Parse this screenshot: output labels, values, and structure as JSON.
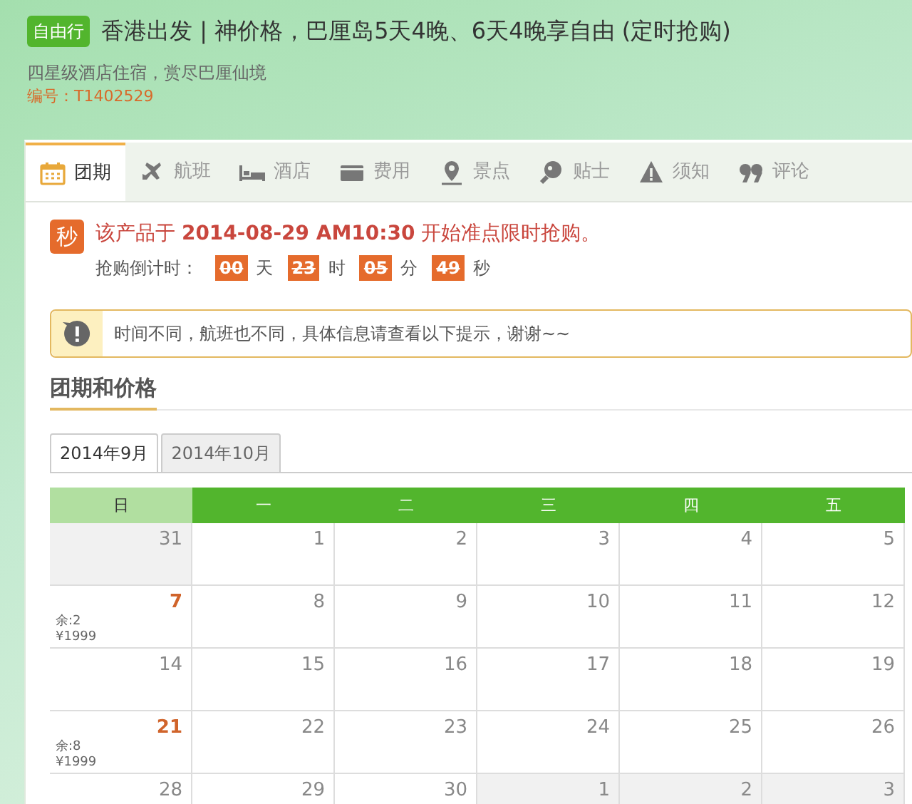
{
  "header": {
    "badge": "自由行",
    "title": "香港出发 | 神价格，巴厘岛5天4晚、6天4晚享自由 (定时抢购)",
    "subtitle": "四星级酒店住宿，赏尽巴厘仙境",
    "code": "编号：T1402529"
  },
  "tabs": [
    {
      "label": "团期",
      "selected": true
    },
    {
      "label": "航班",
      "selected": false
    },
    {
      "label": "酒店",
      "selected": false
    },
    {
      "label": "费用",
      "selected": false
    },
    {
      "label": "景点",
      "selected": false
    },
    {
      "label": "贴士",
      "selected": false
    },
    {
      "label": "须知",
      "selected": false
    },
    {
      "label": "评论",
      "selected": false
    }
  ],
  "sale": {
    "badge": "秒",
    "message": "该产品于 **2014-08-29 AM10:30** 开始准点限时抢购。",
    "countdown_label": "抢购倒计时：",
    "countdown": [
      {
        "value": "00",
        "unit": "天"
      },
      {
        "value": "23",
        "unit": "时"
      },
      {
        "value": "05",
        "unit": "分"
      },
      {
        "value": "49",
        "unit": "秒"
      }
    ]
  },
  "notice": "时间不同，航班也不同，具体信息请查看以下提示，谢谢~~",
  "section_title": "团期和价格",
  "month_tabs": [
    {
      "label": "2014年9月",
      "selected": true
    },
    {
      "label": "2014年10月",
      "selected": false
    }
  ],
  "calendar": {
    "weekdays": [
      "日",
      "一",
      "二",
      "三",
      "四",
      "五"
    ],
    "weeks": [
      [
        {
          "day": "31",
          "in_month": false
        },
        {
          "day": "1",
          "in_month": true
        },
        {
          "day": "2",
          "in_month": true
        },
        {
          "day": "3",
          "in_month": true
        },
        {
          "day": "4",
          "in_month": true
        },
        {
          "day": "5",
          "in_month": true
        }
      ],
      [
        {
          "day": "7",
          "in_month": true,
          "remaining": "余:2",
          "price": "¥1999"
        },
        {
          "day": "8",
          "in_month": true
        },
        {
          "day": "9",
          "in_month": true
        },
        {
          "day": "10",
          "in_month": true
        },
        {
          "day": "11",
          "in_month": true
        },
        {
          "day": "12",
          "in_month": true
        }
      ],
      [
        {
          "day": "14",
          "in_month": true
        },
        {
          "day": "15",
          "in_month": true
        },
        {
          "day": "16",
          "in_month": true
        },
        {
          "day": "17",
          "in_month": true
        },
        {
          "day": "18",
          "in_month": true
        },
        {
          "day": "19",
          "in_month": true
        }
      ],
      [
        {
          "day": "21",
          "in_month": true,
          "remaining": "余:8",
          "price": "¥1999"
        },
        {
          "day": "22",
          "in_month": true
        },
        {
          "day": "23",
          "in_month": true
        },
        {
          "day": "24",
          "in_month": true
        },
        {
          "day": "25",
          "in_month": true
        },
        {
          "day": "26",
          "in_month": true
        }
      ],
      [
        {
          "day": "28",
          "in_month": true
        },
        {
          "day": "29",
          "in_month": true
        },
        {
          "day": "30",
          "in_month": true
        },
        {
          "day": "1",
          "in_month": false
        },
        {
          "day": "2",
          "in_month": false
        },
        {
          "day": "3",
          "in_month": false
        }
      ]
    ]
  }
}
